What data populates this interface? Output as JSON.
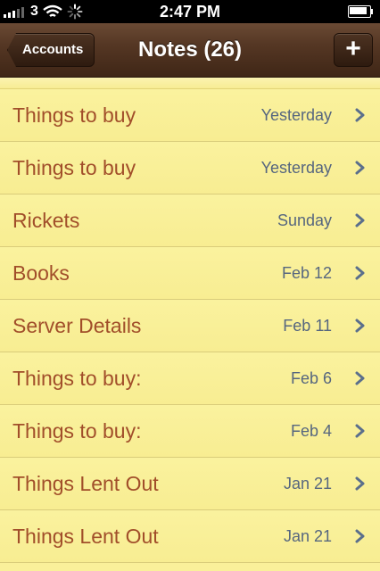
{
  "status_bar": {
    "carrier": "3",
    "time": "2:47 PM",
    "icons": [
      "signal-bars-icon",
      "wifi-icon",
      "activity-spinner-icon",
      "battery-icon"
    ],
    "battery_level": 0.95
  },
  "nav": {
    "back_label": "Accounts",
    "title": "Notes (26)",
    "add_label": "+"
  },
  "notes": [
    {
      "title": "Things to buy",
      "date": "Yesterday"
    },
    {
      "title": "Things to buy",
      "date": "Yesterday"
    },
    {
      "title": "Rickets",
      "date": "Sunday"
    },
    {
      "title": "Books",
      "date": "Feb 12"
    },
    {
      "title": "Server Details",
      "date": "Feb 11"
    },
    {
      "title": "Things to buy:",
      "date": "Feb 6"
    },
    {
      "title": "Things to buy:",
      "date": "Feb 4"
    },
    {
      "title": "Things Lent Out",
      "date": "Jan 21"
    },
    {
      "title": "Things Lent Out",
      "date": "Jan 21"
    }
  ],
  "colors": {
    "note_paper": "#faf09a",
    "title_text": "#a14e2a",
    "date_text": "#56667f",
    "nav_bar": "#553724"
  }
}
